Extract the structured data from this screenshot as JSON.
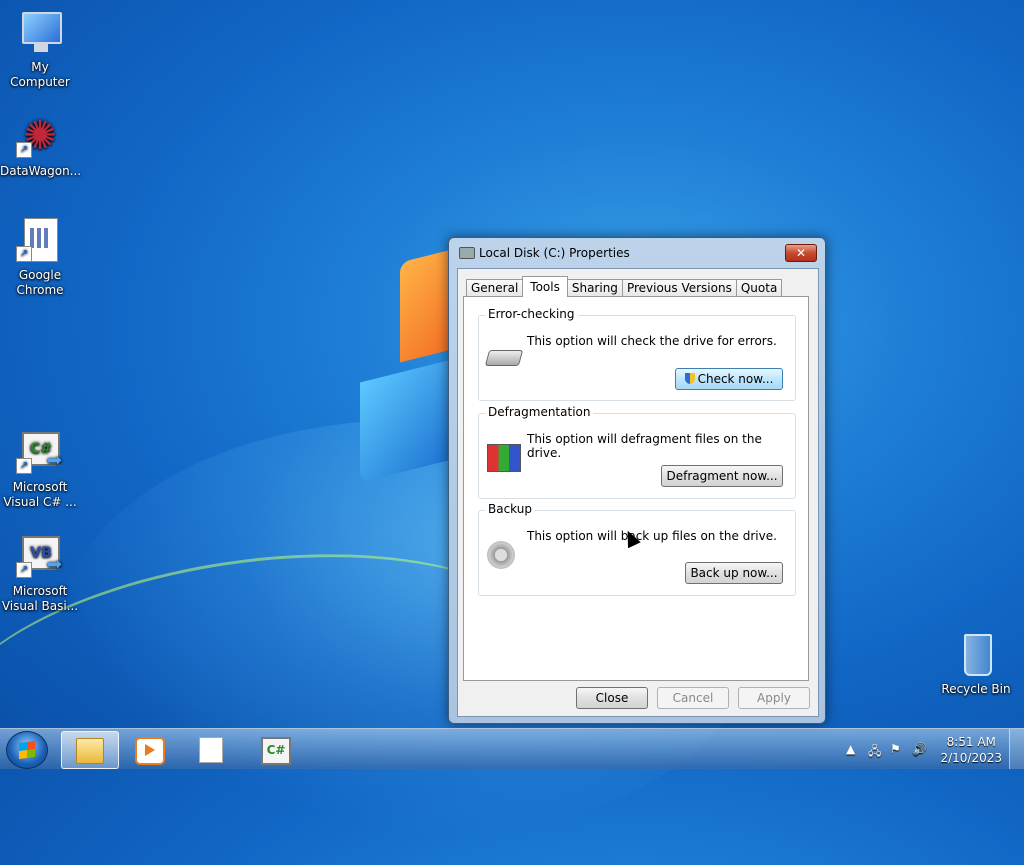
{
  "desktop": {
    "icons": [
      {
        "label": "My Computer",
        "icon": "computer-icon"
      },
      {
        "label": "DataWagon...",
        "icon": "flower-icon"
      },
      {
        "label": "Google Chrome",
        "icon": "document-icon"
      },
      {
        "label": "Microsoft Visual C# ...",
        "icon": "csharp-icon"
      },
      {
        "label": "Microsoft Visual Basi...",
        "icon": "vb-icon"
      },
      {
        "label": "Recycle Bin",
        "icon": "recycle-bin-icon"
      }
    ]
  },
  "dialog": {
    "title": "Local Disk (C:) Properties",
    "close_glyph": "✕",
    "tabs": [
      "General",
      "Tools",
      "Sharing",
      "Previous Versions",
      "Quota"
    ],
    "active_tab": "Tools",
    "groups": [
      {
        "legend": "Error-checking",
        "description": "This option will check the drive for errors.",
        "button": "Check now..."
      },
      {
        "legend": "Defragmentation",
        "description": "This option will defragment files on the drive.",
        "button": "Defragment now..."
      },
      {
        "legend": "Backup",
        "description": "This option will back up files on the drive.",
        "button": "Back up now..."
      }
    ],
    "footer": {
      "close": "Close",
      "cancel": "Cancel",
      "apply": "Apply"
    }
  },
  "taskbar": {
    "tray_arrow": "▲",
    "clock_time": "8:51 AM",
    "clock_date": "2/10/2023",
    "cs_label": "C#"
  }
}
